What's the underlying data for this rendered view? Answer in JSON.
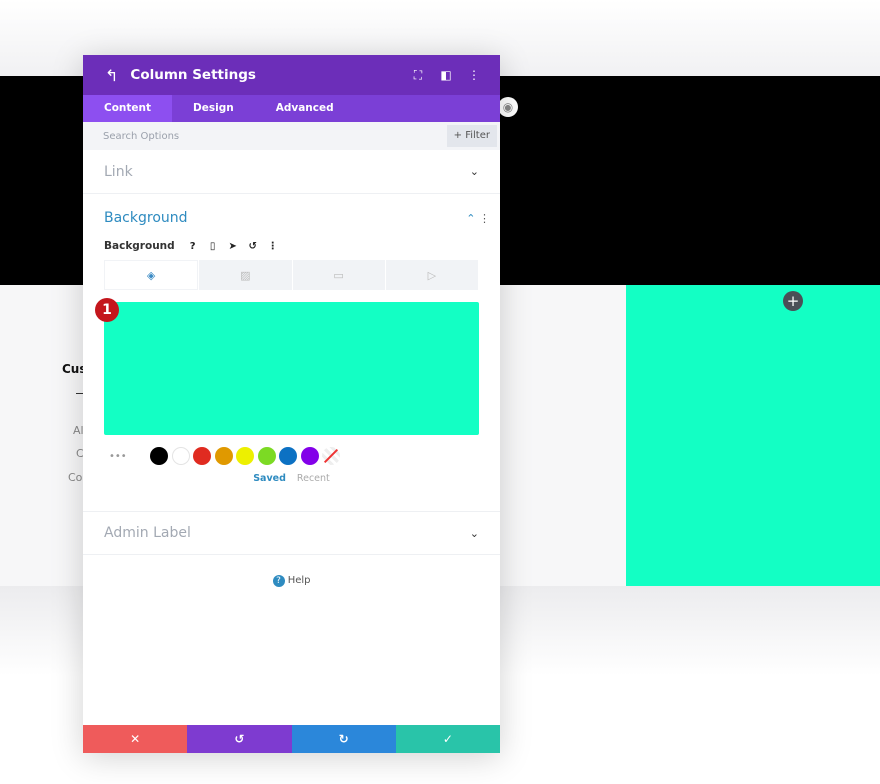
{
  "page": {
    "heading_partial": "Cus",
    "lines_partial": [
      "Al",
      "C",
      "Co"
    ]
  },
  "modal": {
    "title": "Column Settings",
    "tabs": [
      "Content",
      "Design",
      "Advanced"
    ],
    "search_placeholder": "Search Options",
    "filter_label": "+ Filter",
    "sections": {
      "link": "Link",
      "background": "Background",
      "admin_label": "Admin Label"
    },
    "background_label": "Background",
    "badge": "1",
    "selected_color": "#13ffc4",
    "palette": [
      "#000000",
      "#ffffff",
      "#e02b20",
      "#e09900",
      "#edf000",
      "#7cda24",
      "#0c71c3",
      "#8300e9"
    ],
    "saved_label": "Saved",
    "recent_label": "Recent",
    "help_label": "Help"
  },
  "colors": {
    "header": "#6c2eb9",
    "tabs": "#7b3fd6",
    "cancel": "#ef5b5b",
    "undo": "#7e3bd0",
    "redo": "#2b87da",
    "save": "#29c4a9"
  }
}
